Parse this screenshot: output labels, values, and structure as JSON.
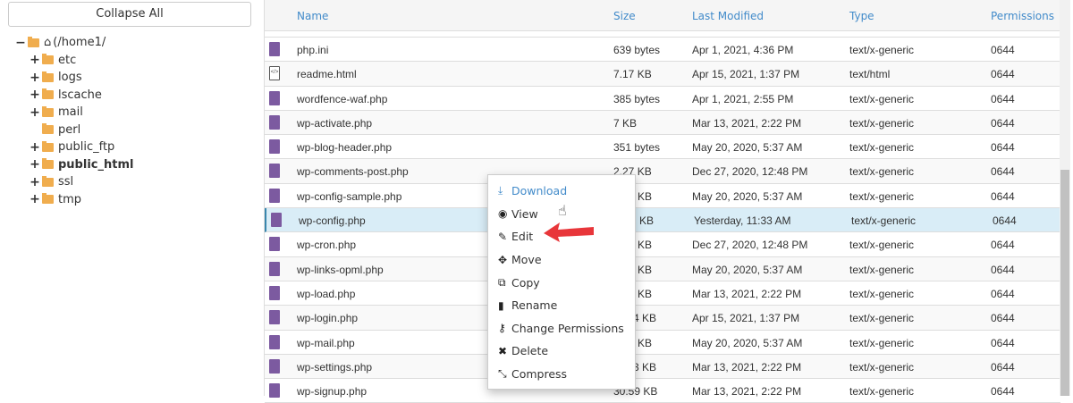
{
  "sidebar": {
    "collapse_label": "Collapse All",
    "root": "(/home1/",
    "folders": [
      {
        "name": "etc",
        "expand": "+"
      },
      {
        "name": "logs",
        "expand": "+"
      },
      {
        "name": "lscache",
        "expand": "+"
      },
      {
        "name": "mail",
        "expand": "+"
      },
      {
        "name": "perl",
        "expand": ""
      },
      {
        "name": "public_ftp",
        "expand": "+"
      },
      {
        "name": "public_html",
        "expand": "+"
      },
      {
        "name": "ssl",
        "expand": "+"
      },
      {
        "name": "tmp",
        "expand": "+"
      }
    ]
  },
  "table": {
    "headers": {
      "name": "Name",
      "size": "Size",
      "modified": "Last Modified",
      "type": "Type",
      "perms": "Permissions"
    },
    "rows": [
      {
        "name": "php.ini",
        "size": "639 bytes",
        "modified": "Apr 1, 2021, 4:36 PM",
        "type": "text/x-generic",
        "perms": "0644"
      },
      {
        "name": "readme.html",
        "size": "7.17 KB",
        "modified": "Apr 15, 2021, 1:37 PM",
        "type": "text/html",
        "perms": "0644"
      },
      {
        "name": "wordfence-waf.php",
        "size": "385 bytes",
        "modified": "Apr 1, 2021, 2:55 PM",
        "type": "text/x-generic",
        "perms": "0644"
      },
      {
        "name": "wp-activate.php",
        "size": "7 KB",
        "modified": "Mar 13, 2021, 2:22 PM",
        "type": "text/x-generic",
        "perms": "0644"
      },
      {
        "name": "wp-blog-header.php",
        "size": "351 bytes",
        "modified": "May 20, 2020, 5:37 AM",
        "type": "text/x-generic",
        "perms": "0644"
      },
      {
        "name": "wp-comments-post.php",
        "size": "2.27 KB",
        "modified": "Dec 27, 2020, 12:48 PM",
        "type": "text/x-generic",
        "perms": "0644"
      },
      {
        "name": "wp-config-sample.php",
        "size": "KB",
        "modified": "May 20, 2020, 5:37 AM",
        "type": "text/x-generic",
        "perms": "0644"
      },
      {
        "name": "wp-config.php",
        "size": "KB",
        "modified": "Yesterday, 11:33 AM",
        "type": "text/x-generic",
        "perms": "0644"
      },
      {
        "name": "wp-cron.php",
        "size": "KB",
        "modified": "Dec 27, 2020, 12:48 PM",
        "type": "text/x-generic",
        "perms": "0644"
      },
      {
        "name": "wp-links-opml.php",
        "size": "KB",
        "modified": "May 20, 2020, 5:37 AM",
        "type": "text/x-generic",
        "perms": "0644"
      },
      {
        "name": "wp-load.php",
        "size": "KB",
        "modified": "Mar 13, 2021, 2:22 PM",
        "type": "text/x-generic",
        "perms": "0644"
      },
      {
        "name": "wp-login.php",
        "size": "4 KB",
        "modified": "Apr 15, 2021, 1:37 PM",
        "type": "text/x-generic",
        "perms": "0644"
      },
      {
        "name": "wp-mail.php",
        "size": "KB",
        "modified": "May 20, 2020, 5:37 AM",
        "type": "text/x-generic",
        "perms": "0644"
      },
      {
        "name": "wp-settings.php",
        "size": "3 KB",
        "modified": "Mar 13, 2021, 2:22 PM",
        "type": "text/x-generic",
        "perms": "0644"
      },
      {
        "name": "wp-signup.php",
        "size": "30.59 KB",
        "modified": "Mar 13, 2021, 2:22 PM",
        "type": "text/x-generic",
        "perms": "0644"
      }
    ]
  },
  "context_menu": [
    {
      "label": "Download",
      "icon": "download-icon",
      "glyph": "⤓"
    },
    {
      "label": "View",
      "icon": "eye-icon",
      "glyph": "◉"
    },
    {
      "label": "Edit",
      "icon": "pencil-icon",
      "glyph": "✎"
    },
    {
      "label": "Move",
      "icon": "move-icon",
      "glyph": "✥"
    },
    {
      "label": "Copy",
      "icon": "copy-icon",
      "glyph": "⧉"
    },
    {
      "label": "Rename",
      "icon": "file-icon",
      "glyph": "▮"
    },
    {
      "label": "Change Permissions",
      "icon": "key-icon",
      "glyph": "⚷"
    },
    {
      "label": "Delete",
      "icon": "times-icon",
      "glyph": "✖"
    },
    {
      "label": "Compress",
      "icon": "compress-icon",
      "glyph": "⤡"
    }
  ],
  "colors": {
    "accent": "#428bca",
    "folder": "#f0ad4e",
    "selected": "#d9edf7",
    "arrow": "#e8363a"
  }
}
